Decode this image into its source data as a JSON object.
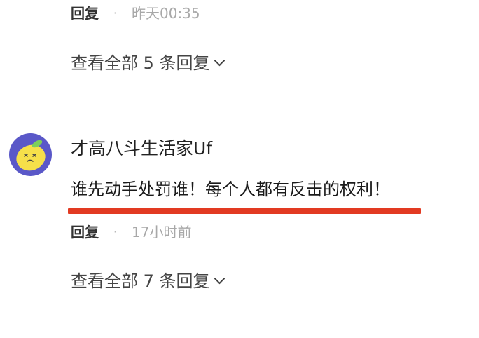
{
  "thread1": {
    "reply_label": "回复",
    "separator": "·",
    "timestamp": "昨天00:35",
    "view_all_label": "查看全部 5 条回复"
  },
  "comment": {
    "username": "才高八斗生活家Uf",
    "text": "谁先动手处罚谁！每个人都有反击的权利！",
    "reply_label": "回复",
    "separator": "·",
    "timestamp": "17小时前",
    "view_all_label": "查看全部 7 条回复",
    "avatar_icon": "lemon-mascot-icon",
    "avatar_color": "#5a58c8",
    "highlight_color": "#e23a22"
  }
}
